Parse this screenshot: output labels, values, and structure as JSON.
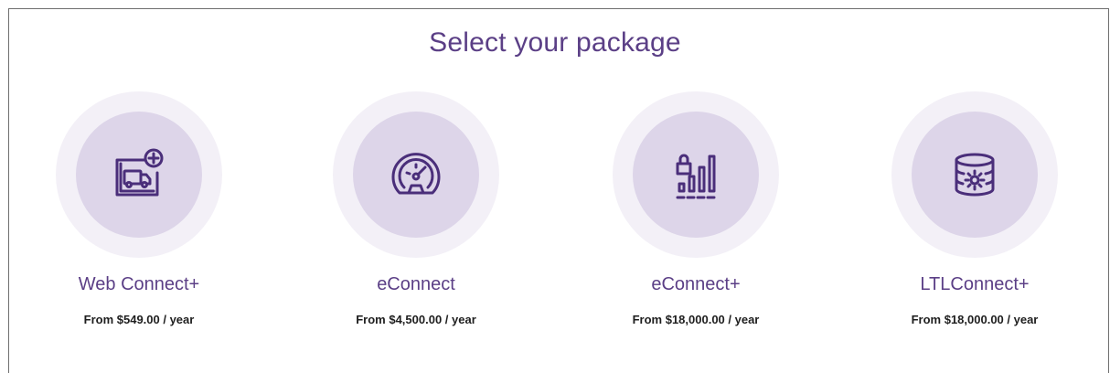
{
  "heading": "Select your package",
  "colors": {
    "accent": "#5b3f86",
    "outer_circle": "#f3f0f7",
    "inner_circle": "#ddd5e9",
    "price_text": "#1e1e1e"
  },
  "packages": [
    {
      "name": "Web Connect+",
      "price": "From $549.00 / year",
      "icon": "truck-screen-plus-icon"
    },
    {
      "name": "eConnect",
      "price": "From $4,500.00 / year",
      "icon": "speedometer-icon"
    },
    {
      "name": "eConnect+",
      "price": "From $18,000.00 / year",
      "icon": "lock-bar-chart-icon"
    },
    {
      "name": "LTLConnect+",
      "price": "From $18,000.00 / year",
      "icon": "database-gear-icon"
    }
  ]
}
